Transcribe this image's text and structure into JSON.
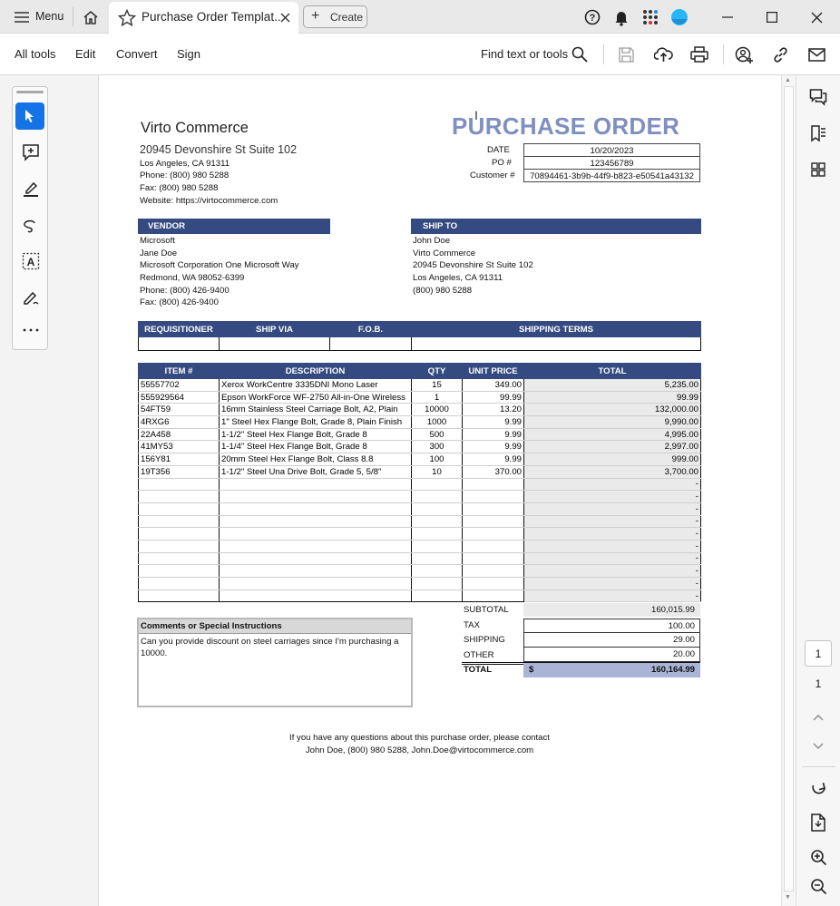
{
  "titlebar": {
    "menu_label": "Menu",
    "tab_title": "Purchase Order Templat..",
    "create_label": "Create"
  },
  "toolbar": {
    "all_tools": "All tools",
    "edit": "Edit",
    "convert": "Convert",
    "sign": "Sign",
    "find": "Find text or tools"
  },
  "company": {
    "name": "Virto Commerce",
    "address1": "20945 Devonshire St Suite 102",
    "city": "Los Angeles, CA 91311",
    "phone": "Phone: (800) 980 5288",
    "fax": "Fax: (800) 980 5288",
    "website": "Website: https://virtocommerce.com"
  },
  "po": {
    "title": "PURCHASE ORDER",
    "date_label": "DATE",
    "date": "10/20/2023",
    "po_label": "PO #",
    "po_number": "123456789",
    "customer_label": "Customer #",
    "customer": "70894461-3b9b-44f9-b823-e50541a43132"
  },
  "vendor": {
    "header": "VENDOR",
    "lines": [
      "Microsoft",
      "Jane Doe",
      "Microsoft Corporation One Microsoft Way",
      "Redmond, WA 98052-6399",
      "Phone: (800) 426-9400",
      "Fax: (800) 426-9400"
    ]
  },
  "shipto": {
    "header": "SHIP TO",
    "lines": [
      "John Doe",
      "Virto Commerce",
      "20945 Devonshire St Suite 102",
      "Los Angeles, CA 91311",
      "(800) 980 5288"
    ]
  },
  "shipping_headers": {
    "requisitioner": "REQUISITIONER",
    "ship_via": "SHIP VIA",
    "fob": "F.O.B.",
    "terms": "SHIPPING TERMS"
  },
  "items_headers": {
    "item": "ITEM #",
    "description": "DESCRIPTION",
    "qty": "QTY",
    "unit_price": "UNIT PRICE",
    "total": "TOTAL"
  },
  "items": [
    {
      "item": "55557702",
      "description": "Xerox WorkCentre 3335DNI Mono Laser",
      "qty": "15",
      "price": "349.00",
      "total": "5,235.00"
    },
    {
      "item": "555929564",
      "description": "Epson WorkForce WF-2750 All-in-One Wireless",
      "qty": "1",
      "price": "99.99",
      "total": "99.99"
    },
    {
      "item": "54FT59",
      "description": "16mm Stainless Steel Carriage Bolt, A2, Plain",
      "qty": "10000",
      "price": "13.20",
      "total": "132,000.00"
    },
    {
      "item": "4RXG6",
      "description": "1\" Steel Hex Flange Bolt, Grade 8, Plain Finish",
      "qty": "1000",
      "price": "9.99",
      "total": "9,990.00"
    },
    {
      "item": "22A458",
      "description": "1-1/2\" Steel Hex Flange Bolt, Grade 8",
      "qty": "500",
      "price": "9.99",
      "total": "4,995.00"
    },
    {
      "item": "41MY53",
      "description": "1-1/4\" Steel Hex Flange Bolt, Grade 8",
      "qty": "300",
      "price": "9.99",
      "total": "2,997.00"
    },
    {
      "item": "156Y81",
      "description": "20mm Steel Hex Flange Bolt, Class 8.8",
      "qty": "100",
      "price": "9.99",
      "total": "999.00"
    },
    {
      "item": "19T356",
      "description": "1-1/2\" Steel Una Drive Bolt, Grade 5, 5/8\"",
      "qty": "10",
      "price": "370.00",
      "total": "3,700.00"
    }
  ],
  "empty_total": "-",
  "comments": {
    "header": "Comments or Special Instructions",
    "text": "Can you provide discount on steel carriages since I'm purchasing a 10000."
  },
  "totals": {
    "subtotal_label": "SUBTOTAL",
    "subtotal": "160,015.99",
    "tax_label": "TAX",
    "tax": "100.00",
    "shipping_label": "SHIPPING",
    "shipping": "29.00",
    "other_label": "OTHER",
    "other": "20.00",
    "total_label": "TOTAL",
    "currency": "$",
    "total": "160,164.99"
  },
  "footer": {
    "line1": "If you have any questions about this purchase order, please contact",
    "line2": "John Doe, (800) 980 5288, John.Doe@virtocommerce.com"
  },
  "pages": {
    "current": "1",
    "total": "1"
  },
  "colors": {
    "accent": "#344a80",
    "title": "#7f8fbf",
    "highlight": "#a9b4d6",
    "tool_active": "#1473e6"
  }
}
